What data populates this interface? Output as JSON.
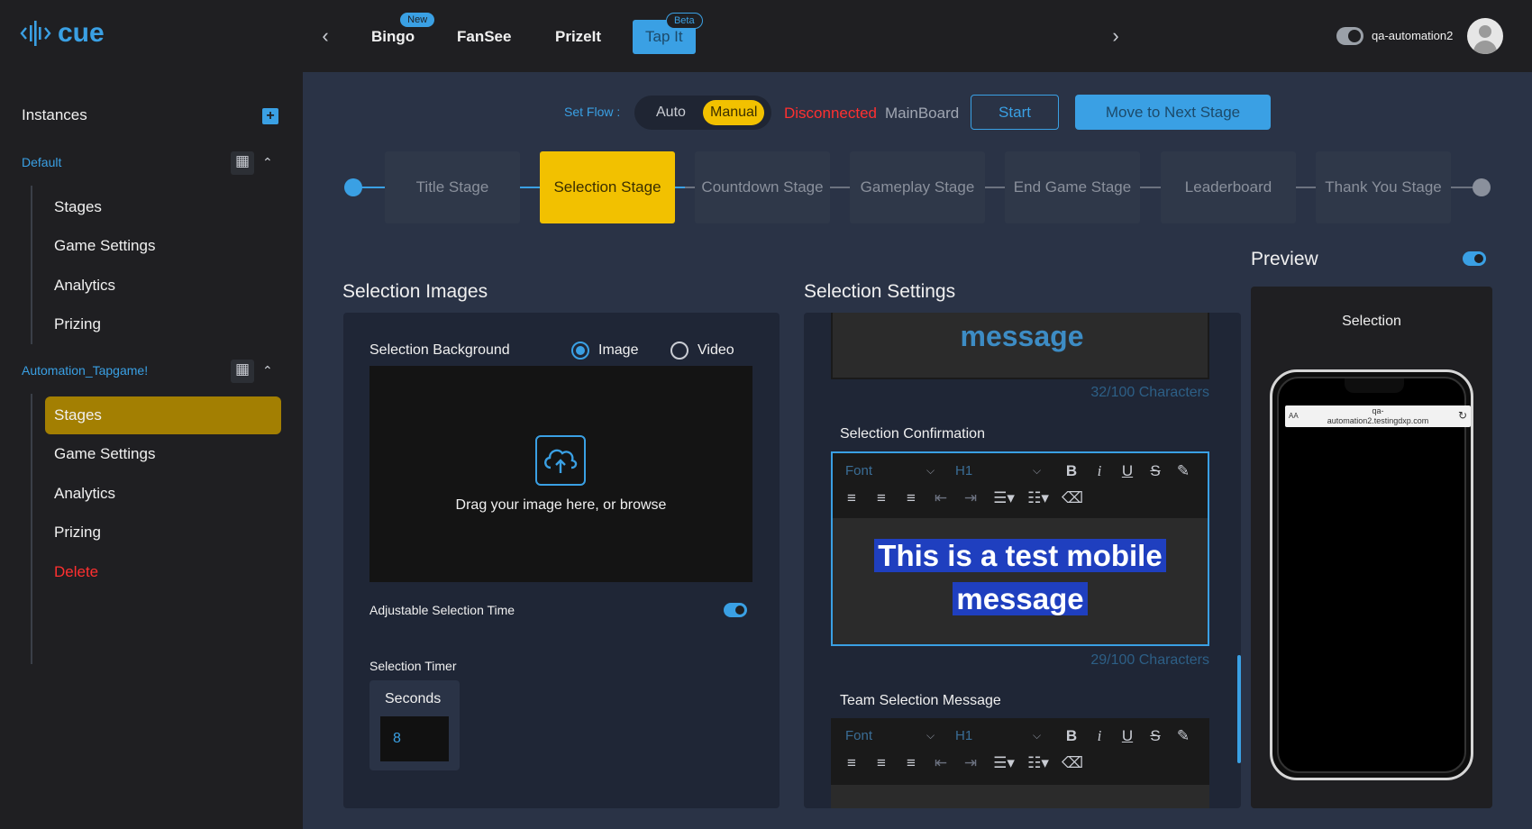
{
  "brand": {
    "name": "cue",
    "accent": "#3aa0e4",
    "highlight": "#f2c100"
  },
  "topbar": {
    "apps": [
      {
        "label": "Bingo",
        "badge": "New"
      },
      {
        "label": "FanSee",
        "badge": ""
      },
      {
        "label": "PrizeIt",
        "badge": ""
      },
      {
        "label": "Tap It",
        "badge": "Beta",
        "active": true
      }
    ],
    "username": "qa-automation2"
  },
  "sidebar": {
    "heading": "Instances",
    "groups": [
      {
        "name": "Default",
        "items": [
          "Stages",
          "Game Settings",
          "Analytics",
          "Prizing"
        ]
      },
      {
        "name": "Automation_Tapgame!",
        "items": [
          "Stages",
          "Game Settings",
          "Analytics",
          "Prizing",
          "Delete"
        ],
        "active_item": "Stages"
      }
    ]
  },
  "flow": {
    "label": "Set Flow :",
    "options": [
      "Auto",
      "Manual"
    ],
    "selected": "Manual",
    "status": "Disconnected",
    "board": "MainBoard",
    "start_label": "Start",
    "next_label": "Move to Next Stage"
  },
  "stages": [
    "Title Stage",
    "Selection Stage",
    "Countdown Stage",
    "Gameplay Stage",
    "End Game Stage",
    "Leaderboard",
    "Thank You Stage"
  ],
  "active_stage": "Selection Stage",
  "images": {
    "title": "Selection Images",
    "background_label": "Selection Background",
    "media_options": [
      "Image",
      "Video"
    ],
    "media_selected": "Image",
    "upload_text": "Drag your image here, or browse",
    "adjustable_label": "Adjustable Selection Time",
    "adjustable_on": true,
    "timer_label": "Selection Timer",
    "timer_unit": "Seconds",
    "timer_value": "8"
  },
  "settings": {
    "title": "Selection Settings",
    "top_message": "message",
    "top_count": "32/100 Characters",
    "confirmation_label": "Selection Confirmation",
    "font_placeholder": "Font",
    "heading_value": "H1",
    "confirmation_text_line1": "This is a test mobile",
    "confirmation_text_line2": "message",
    "confirmation_count": "29/100 Characters",
    "team_label": "Team Selection Message"
  },
  "preview": {
    "title": "Preview",
    "enabled": true,
    "screen_title": "Selection",
    "url_prefix": "AA",
    "url_line1": "qa-",
    "url_line2": "automation2.testingdxp.com"
  }
}
